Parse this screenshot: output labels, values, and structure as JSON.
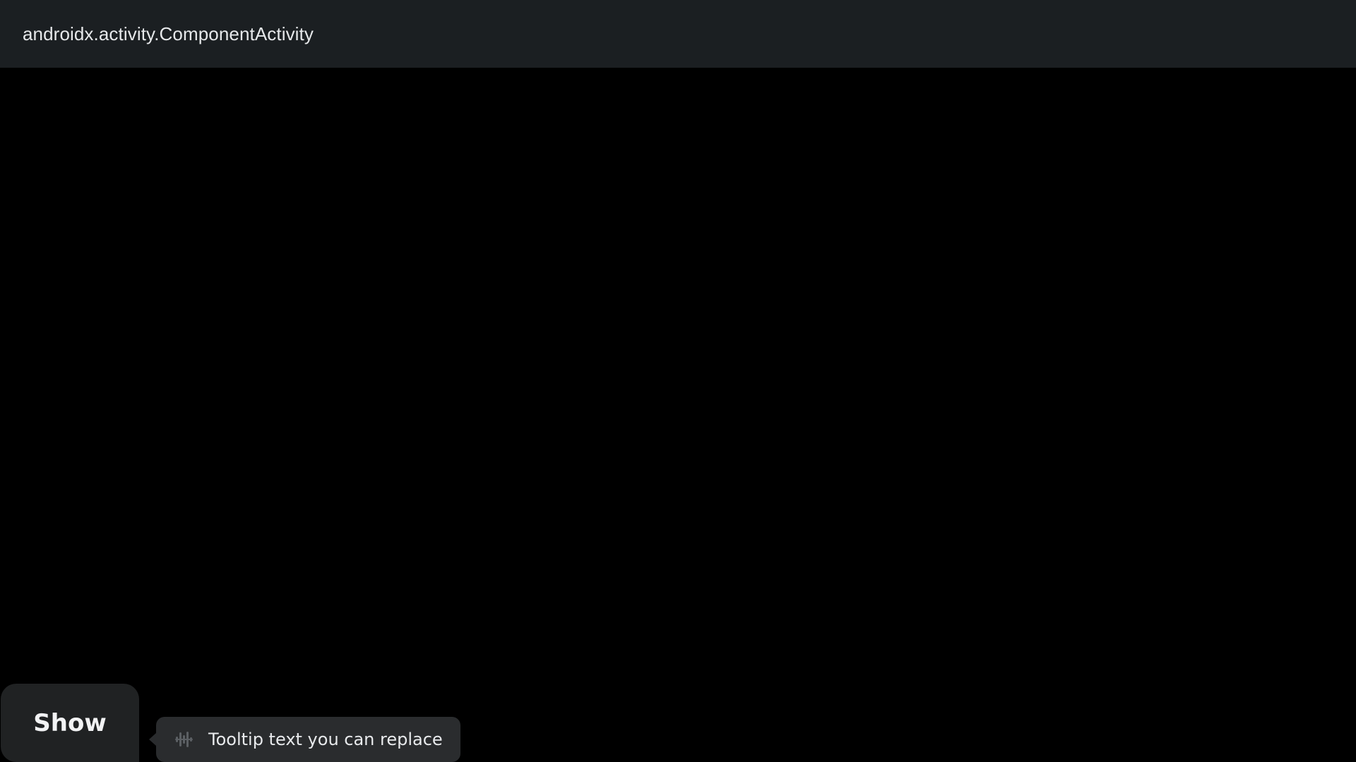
{
  "app_bar": {
    "title": "androidx.activity.ComponentActivity",
    "background": "#1b1f22"
  },
  "content": {
    "background": "#000000"
  },
  "show_button": {
    "label": "Show",
    "background": "#202223"
  },
  "tooltip": {
    "icon": "sparkle-waveform-icon",
    "text": "Tooltip text you can replace",
    "background": "#2a2c2e"
  }
}
